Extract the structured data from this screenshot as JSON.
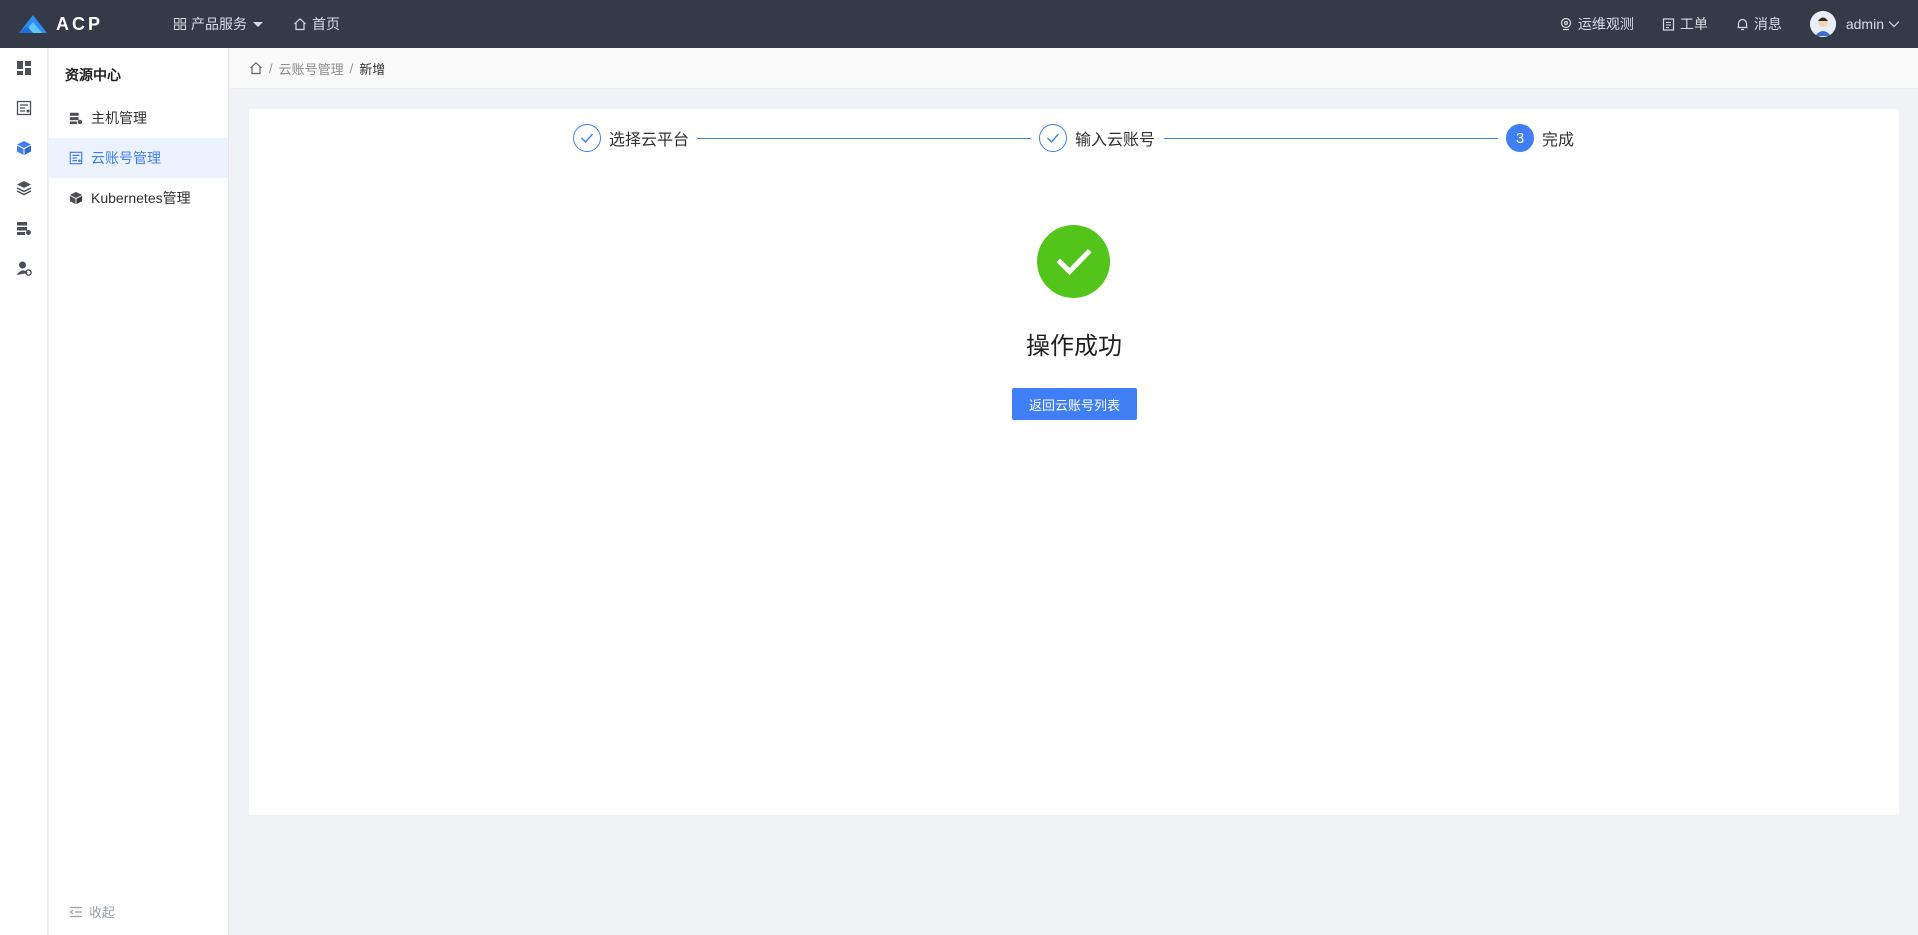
{
  "app": {
    "logo_text": "ACP"
  },
  "topnav": {
    "products": "产品服务",
    "home": "首页",
    "ops": "运维观测",
    "tickets": "工单",
    "messages": "消息",
    "user": "admin"
  },
  "rail": {
    "icons": [
      "dashboard-icon",
      "resource-icon",
      "cube-icon",
      "layers-icon",
      "server-icon",
      "user-settings-icon"
    ],
    "active": "cube-icon"
  },
  "sidemenu": {
    "title": "资源中心",
    "items": [
      {
        "label": "主机管理",
        "icon": "server-icon"
      },
      {
        "label": "云账号管理",
        "icon": "cloud-account-icon",
        "active": true
      },
      {
        "label": "Kubernetes管理",
        "icon": "cube-icon"
      }
    ],
    "collapse": "收起"
  },
  "breadcrumb": {
    "items": [
      "云账号管理",
      "新增"
    ]
  },
  "steps": [
    {
      "label": "选择云平台",
      "status": "done"
    },
    {
      "label": "输入云账号",
      "status": "done"
    },
    {
      "label": "完成",
      "number": "3",
      "status": "current"
    }
  ],
  "result": {
    "title": "操作成功",
    "button": "返回云账号列表"
  },
  "colors": {
    "topbar": "#343a48",
    "primary": "#3f7ef5",
    "success": "#52c41a",
    "active_bg": "#ecf3ff"
  }
}
